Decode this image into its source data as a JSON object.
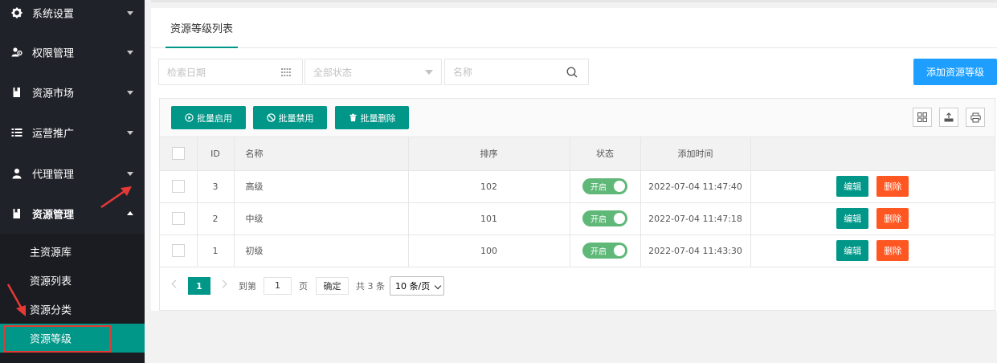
{
  "sidebar": {
    "items": [
      {
        "label": "系统设置",
        "icon": "gear-icon"
      },
      {
        "label": "权限管理",
        "icon": "users-icon"
      },
      {
        "label": "资源市场",
        "icon": "bookmark-icon"
      },
      {
        "label": "运营推广",
        "icon": "list-icon"
      },
      {
        "label": "代理管理",
        "icon": "user-icon"
      },
      {
        "label": "资源管理",
        "icon": "bookmark-icon"
      }
    ],
    "sub_items": [
      {
        "label": "主资源库"
      },
      {
        "label": "资源列表"
      },
      {
        "label": "资源分类"
      },
      {
        "label": "资源等级"
      }
    ],
    "active_sub": "资源等级"
  },
  "tabs": {
    "active": "资源等级列表"
  },
  "search": {
    "date_placeholder": "检索日期",
    "status_placeholder": "全部状态",
    "name_placeholder": "名称"
  },
  "add_button": "添加资源等级",
  "toolbar": {
    "enable_label": "批量启用",
    "disable_label": "批量禁用",
    "delete_label": "批量删除"
  },
  "table": {
    "headers": {
      "id": "ID",
      "name": "名称",
      "sort": "排序",
      "status": "状态",
      "created": "添加时间"
    },
    "rows": [
      {
        "id": "3",
        "name": "高级",
        "sort": "102",
        "status": "开启",
        "created": "2022-07-04 11:47:40",
        "edit": "编辑",
        "delete": "删除"
      },
      {
        "id": "2",
        "name": "中级",
        "sort": "101",
        "status": "开启",
        "created": "2022-07-04 11:47:18",
        "edit": "编辑",
        "delete": "删除"
      },
      {
        "id": "1",
        "name": "初级",
        "sort": "100",
        "status": "开启",
        "created": "2022-07-04 11:43:30",
        "edit": "编辑",
        "delete": "删除"
      }
    ]
  },
  "pager": {
    "current": "1",
    "goto_label": "到第",
    "goto_value": "1",
    "page_unit": "页",
    "ok_label": "确定",
    "total": "共 3 条",
    "page_size": "10 条/页"
  },
  "colors": {
    "sidebar_bg": "#20222a",
    "accent": "#009688",
    "blue": "#1e9fff",
    "danger": "#ff5722",
    "switch_on": "#5fb878"
  }
}
